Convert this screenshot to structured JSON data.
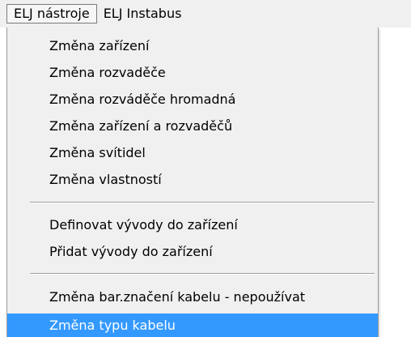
{
  "menubar": {
    "items": [
      {
        "label": "ELJ nástroje"
      },
      {
        "label": "ELJ Instabus"
      }
    ]
  },
  "menu": {
    "group1": [
      {
        "label": "Změna zařízení"
      },
      {
        "label": "Změna rozvaděče"
      },
      {
        "label": "Změna rozváděče hromadná"
      },
      {
        "label": "Změna zařízení a rozvaděčů"
      },
      {
        "label": "Změna svítidel"
      },
      {
        "label": "Změna vlastností"
      }
    ],
    "group2": [
      {
        "label": "Definovat vývody do zařízení"
      },
      {
        "label": "Přidat vývody do zařízení"
      }
    ],
    "group3": [
      {
        "label": "Změna bar.značení kabelu - nepoužívat"
      },
      {
        "label": "Změna typu kabelu",
        "selected": true
      }
    ]
  },
  "colors": {
    "menu_background": "#f0f0f0",
    "selection_background": "#3399ff",
    "selection_text": "#ffffff",
    "separator": "#a0a0a0"
  }
}
